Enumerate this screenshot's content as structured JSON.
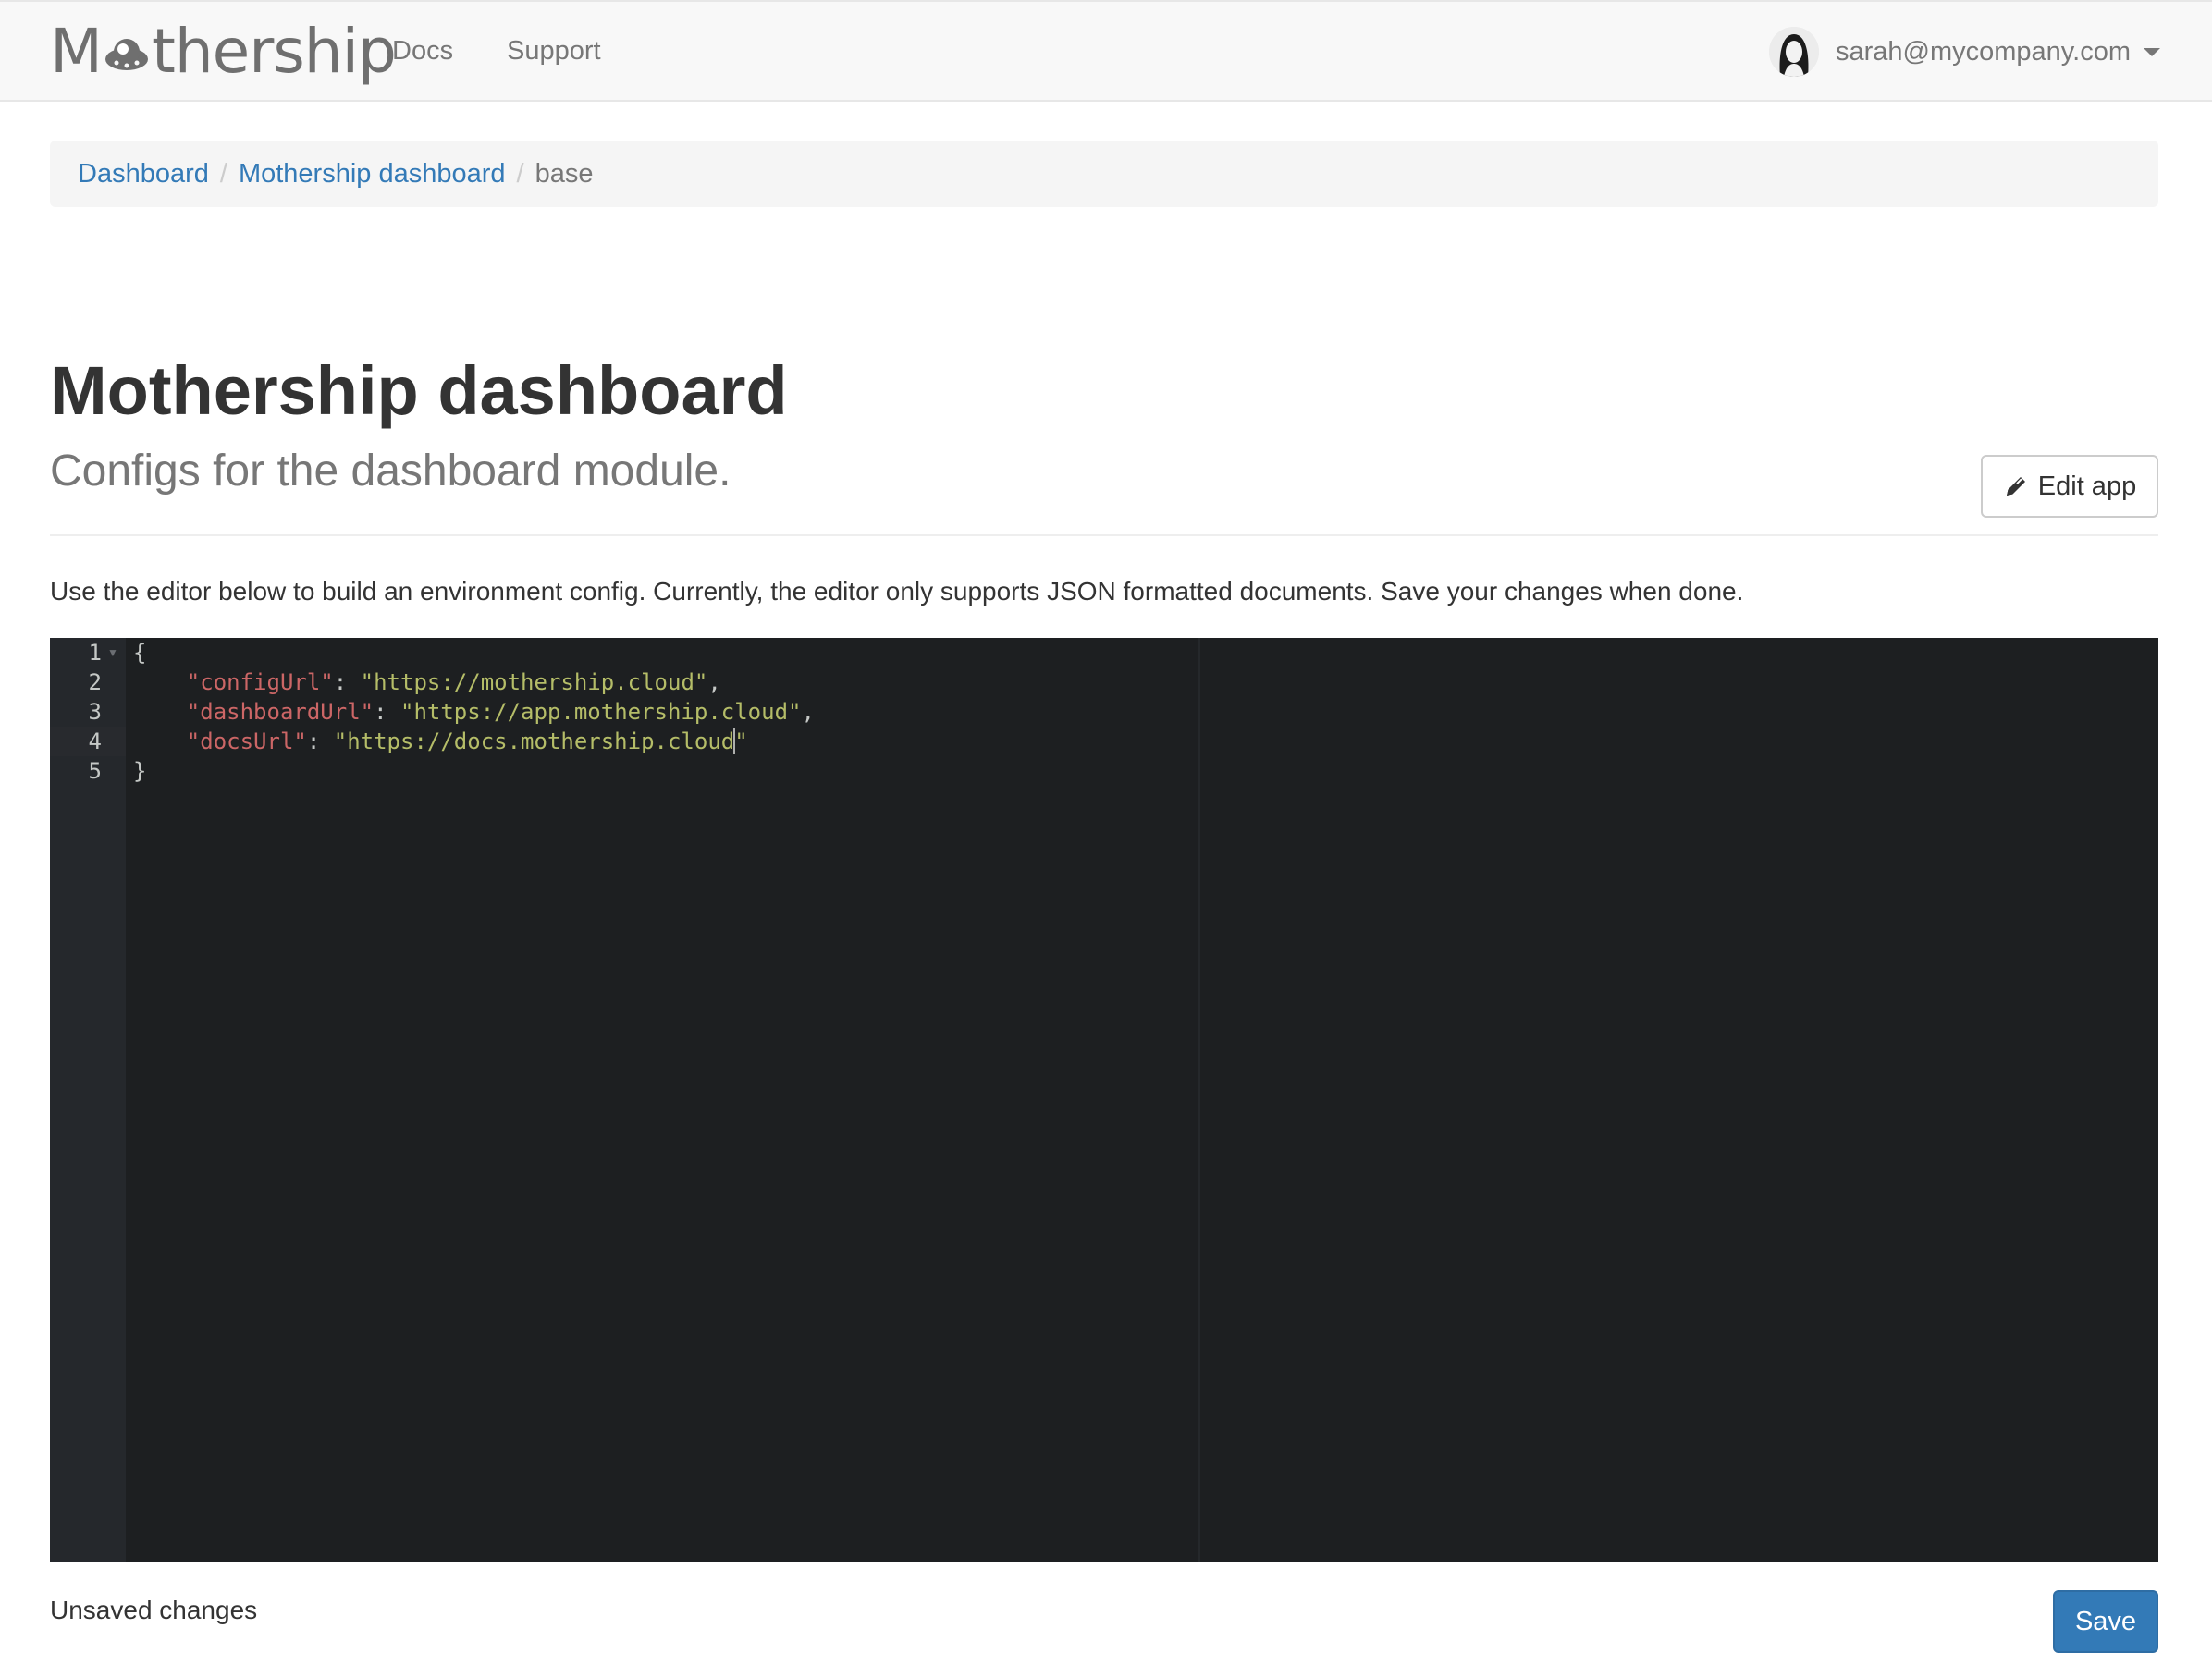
{
  "navbar": {
    "brand": {
      "prefix": "M",
      "suffix": "thership"
    },
    "links": [
      {
        "label": "Docs"
      },
      {
        "label": "Support"
      }
    ],
    "user": {
      "email": "sarah@mycompany.com"
    }
  },
  "breadcrumb": {
    "items": [
      {
        "label": "Dashboard"
      },
      {
        "label": "Mothership dashboard"
      }
    ],
    "active": "base",
    "separator": "/"
  },
  "header": {
    "title": "Mothership dashboard",
    "subtitle": "Configs for the dashboard module.",
    "edit_button_label": "Edit app"
  },
  "intro_text": "Use the editor below to build an environment config. Currently, the editor only supports JSON formatted documents. Save your changes when done.",
  "editor": {
    "line_numbers": [
      "1",
      "2",
      "3",
      "4",
      "5"
    ],
    "open_brace": "{",
    "close_brace": "}",
    "entries": [
      {
        "key": "\"configUrl\"",
        "sep": ": ",
        "value": "\"https://mothership.cloud\"",
        "trail": ","
      },
      {
        "key": "\"dashboardUrl\"",
        "sep": ": ",
        "value": "\"https://app.mothership.cloud\"",
        "trail": ","
      },
      {
        "key": "\"docsUrl\"",
        "sep": ": ",
        "value_before_cursor": "\"https://docs.mothership.cloud",
        "value_after_cursor": "\""
      }
    ]
  },
  "footer": {
    "status": "Unsaved changes",
    "save_label": "Save"
  },
  "colors": {
    "link": "#337ab7",
    "primary_button": "#337ab7",
    "editor_bg": "#1d1f21",
    "json_key": "#cc6666",
    "json_string": "#b5bd68"
  },
  "icons": {
    "brand_o": "ufo-icon",
    "edit": "pencil-icon",
    "user_menu": "caret-down-icon"
  }
}
